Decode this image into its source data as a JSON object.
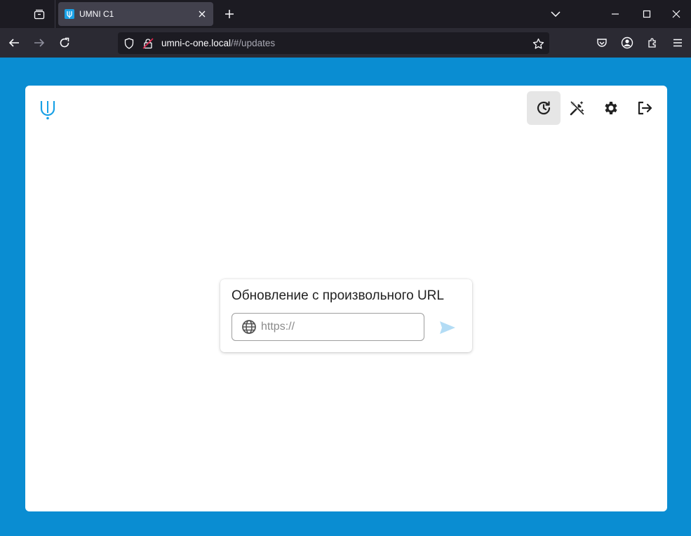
{
  "browser": {
    "tab_title": "UMNI C1",
    "url_host": "umni-c-one.local",
    "url_path": "/#/updates"
  },
  "page": {
    "update_title": "Обновление с произвольного URL",
    "url_placeholder": "https://",
    "url_value": ""
  },
  "colors": {
    "page_background": "#0a8dd2",
    "accent": "#19a1e6",
    "send_disabled": "#b3dcf5"
  },
  "icons": {
    "toolbar": [
      "update-history-icon",
      "auto-fix-icon",
      "gear-icon",
      "logout-icon"
    ]
  }
}
